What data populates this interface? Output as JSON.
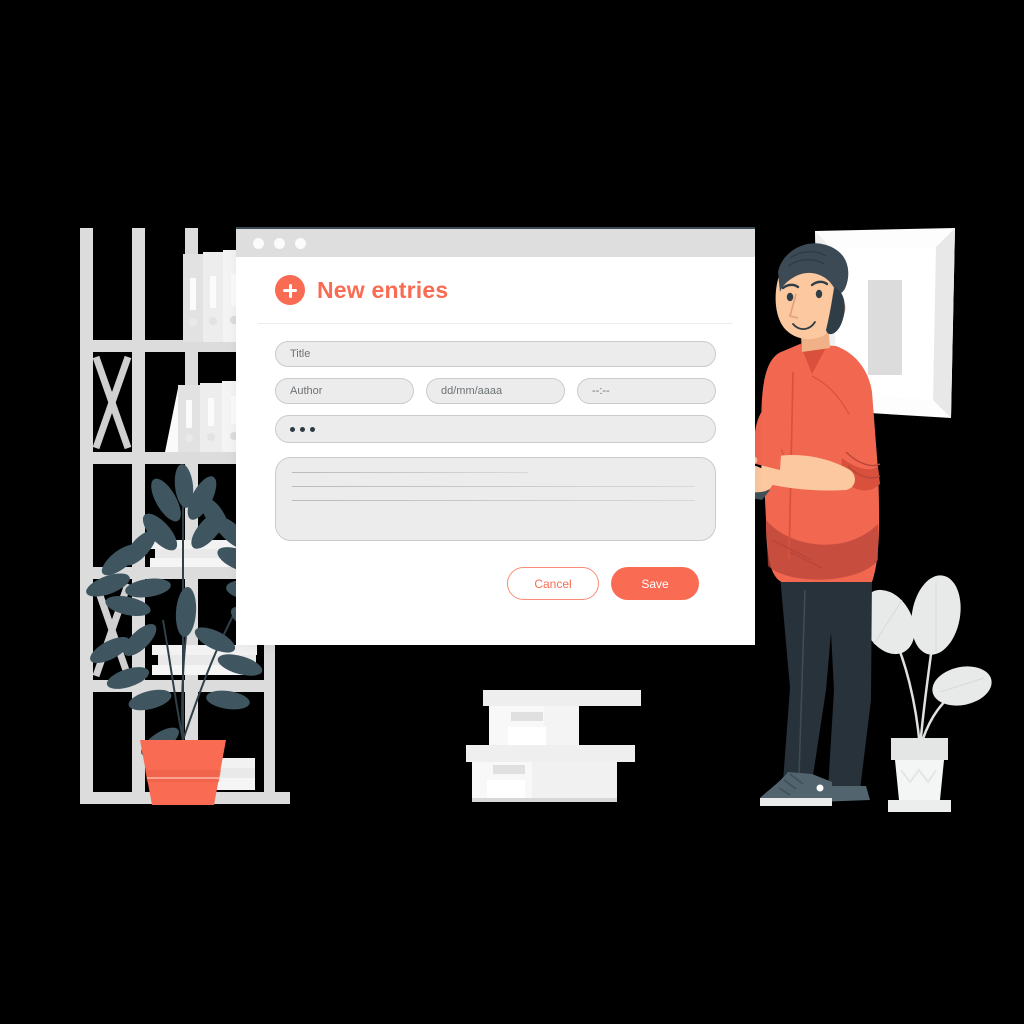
{
  "scene": {
    "background": "#000000",
    "accent": "#fa6b53",
    "dark": "#3b4953",
    "light_gray": "#e3e3e3",
    "field_gray": "#ececec"
  },
  "window": {
    "titlebar": {
      "dots": [
        "close-dot",
        "minimize-dot",
        "maximize-dot"
      ],
      "dot_color": "#fbfbfb",
      "bar_color": "#dedede"
    },
    "header": {
      "icon": "plus-circle-icon",
      "title": "New entries"
    },
    "form": {
      "title_field": {
        "placeholder": "Title",
        "value": ""
      },
      "author_field": {
        "placeholder": "Author",
        "value": ""
      },
      "date_field": {
        "placeholder": "dd/mm/aaaa",
        "value": ""
      },
      "time_field": {
        "placeholder": "--:--",
        "value": ""
      },
      "select_field": {
        "icon": "ellipsis-icon",
        "value": ""
      },
      "description_field": {
        "placeholder": "",
        "value": "",
        "line_count": 3
      }
    },
    "actions": {
      "cancel_label": "Cancel",
      "save_label": "Save"
    }
  },
  "illustration": {
    "shelf": {
      "name": "bookshelf",
      "binder_groups": 2,
      "color": "#dcdcdc"
    },
    "plant_left": {
      "name": "potted-plant-left",
      "pot_color": "#fa6b53",
      "leaf_color": "#3f5660"
    },
    "plant_right": {
      "name": "potted-plant-right",
      "pot_color": "#e6e8e8",
      "leaf_color": "#e8eaea"
    },
    "boxes": {
      "name": "storage-boxes",
      "count": 2,
      "color": "#f1f1f1"
    },
    "picture_frame": {
      "name": "wall-picture-frame",
      "color": "#fdfdfd"
    },
    "person": {
      "name": "man-with-laptop",
      "shirt_color": "#f1674f",
      "pants_color": "#27323a",
      "skin_color": "#fbc8a0",
      "hair_color": "#3b4a55",
      "shoe_color": "#52646e",
      "laptop_color": "#3e5059"
    }
  }
}
